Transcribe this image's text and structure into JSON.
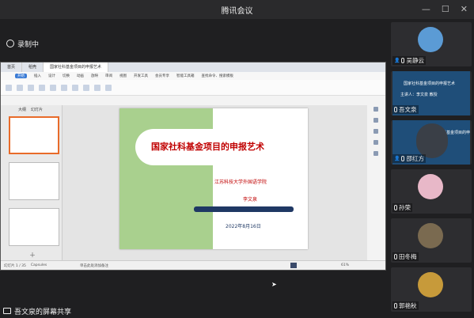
{
  "window": {
    "title": "腾讯会议"
  },
  "recording": {
    "label": "录制中"
  },
  "shared_app": {
    "tabs": [
      "首页",
      "稻壳",
      "国家社科基金项目的申报艺术"
    ],
    "menu": [
      "开始",
      "插入",
      "设计",
      "切换",
      "动画",
      "放映",
      "审阅",
      "视图",
      "开发工具",
      "会员专享",
      "智能工具箱"
    ],
    "menu_selected": "开始",
    "search_placeholder": "查找命令、搜索模板",
    "panel_tabs": [
      "大纲",
      "幻灯片"
    ],
    "slide": {
      "title": "国家社科基金项目的申报艺术",
      "school": "江苏科技大学外国语学院",
      "author": "李文泉",
      "date": "2022年8月16日"
    },
    "status": {
      "page": "幻灯片 1 / 35",
      "theme": "Capsules",
      "notes": "单击此处添加备注",
      "zoom": "61%"
    }
  },
  "screen_share": {
    "label": "吾文泉的屏幕共享"
  },
  "participants": [
    {
      "name": "吴静云"
    },
    {
      "name": "吾文泉",
      "slide_title": "国家社科基金项目的申报艺术",
      "slide_sub": "主讲人：李文泉 教授"
    },
    {
      "name": "邵红方",
      "slide_title": "国家社科基金项目的申报艺术"
    },
    {
      "name": "孙荣"
    },
    {
      "name": "田冬梅"
    },
    {
      "name": "郭艳秋"
    }
  ],
  "colors": {
    "slide_green": "#a9d08e",
    "slide_red": "#c00000",
    "slide_navy": "#1f3864",
    "wps_orange": "#e86b2a"
  }
}
